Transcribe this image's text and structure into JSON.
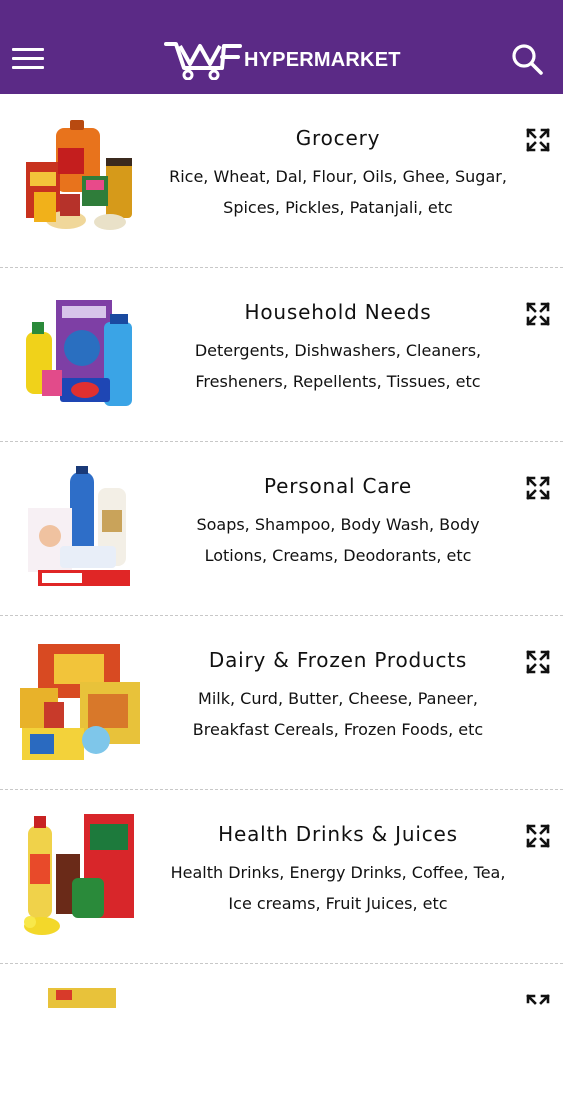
{
  "header": {
    "brand": "HYPERMARKET",
    "background_color": "#5b2a86",
    "icons": {
      "menu": "hamburger-menu-icon",
      "search": "search-icon",
      "logo": "cart-logo-icon"
    }
  },
  "categories": [
    {
      "title": "Grocery",
      "desc_line1": "Rice, Wheat, Dal, Flour, Oils, Ghee, Sugar,",
      "desc_line2": "Spices, Pickles, Patanjali, etc"
    },
    {
      "title": "Household Needs",
      "desc_line1": "Detergents, Dishwashers, Cleaners,",
      "desc_line2": "Fresheners, Repellents, Tissues, etc"
    },
    {
      "title": "Personal Care",
      "desc_line1": "Soaps, Shampoo, Body Wash, Body",
      "desc_line2": "Lotions, Creams, Deodorants, etc"
    },
    {
      "title": "Dairy & Frozen Products",
      "desc_line1": "Milk, Curd, Butter, Cheese, Paneer,",
      "desc_line2": "Breakfast Cereals, Frozen Foods, etc"
    },
    {
      "title": "Health Drinks & Juices",
      "desc_line1": "Health Drinks, Energy Drinks, Coffee, Tea,",
      "desc_line2": "Ice creams, Fruit Juices, etc"
    }
  ]
}
